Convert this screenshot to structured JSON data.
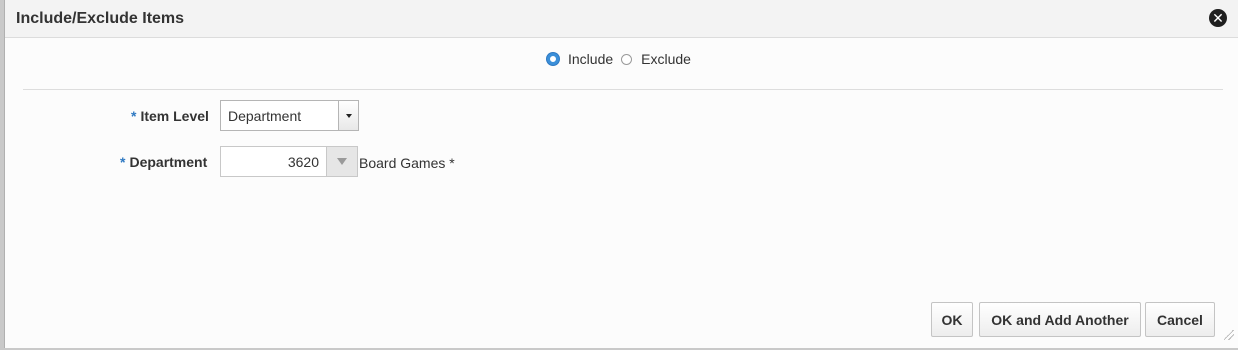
{
  "dialog": {
    "title": "Include/Exclude Items",
    "close_icon": "close-circle-icon"
  },
  "mode": {
    "options": [
      {
        "label": "Include",
        "checked": true
      },
      {
        "label": "Exclude",
        "checked": false
      }
    ]
  },
  "form": {
    "required_marker": "*",
    "item_level": {
      "label": "Item Level",
      "value": "Department"
    },
    "department": {
      "label": "Department",
      "value": "3620",
      "description": "Board Games *"
    }
  },
  "buttons": {
    "ok": "OK",
    "ok_add_another": "OK and Add Another",
    "cancel": "Cancel"
  },
  "colors": {
    "accent": "#2f79c2",
    "title_bar": "#f3f3f3"
  }
}
